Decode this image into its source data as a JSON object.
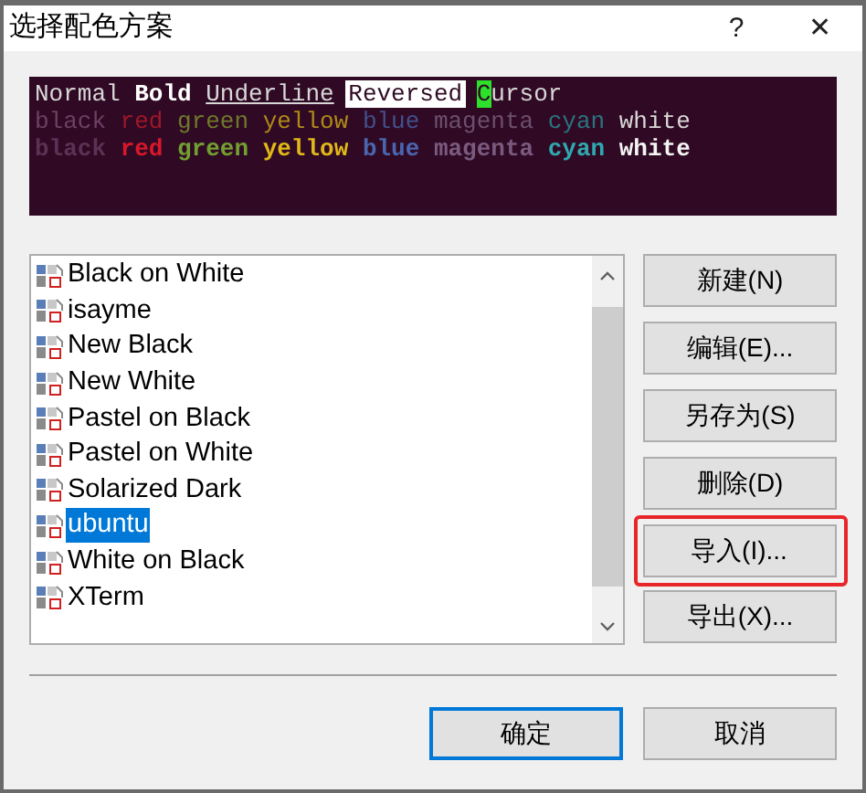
{
  "window": {
    "title": "选择配色方案",
    "help": "?",
    "close": "✕"
  },
  "preview": {
    "lines": [
      {
        "words": [
          {
            "parts": [
              {
                "text": "Normal",
                "kind": "normal",
                "color": "#d8d8d8"
              }
            ]
          },
          {
            "parts": [
              {
                "text": "Bold",
                "kind": "bold",
                "color": "#ffffff"
              }
            ]
          },
          {
            "parts": [
              {
                "text": "Underline",
                "kind": "underline",
                "color": "#d8d8d8"
              }
            ]
          },
          {
            "parts": [
              {
                "text": "Reversed",
                "kind": "reversed",
                "color": "#ffffff"
              }
            ]
          },
          {
            "parts": [
              {
                "text": "C",
                "kind": "cursor",
                "color": "#2ce02c"
              },
              {
                "text": "ursor",
                "kind": "normal",
                "color": "#d8d8d8"
              }
            ]
          }
        ]
      },
      {
        "words": [
          {
            "parts": [
              {
                "text": "black",
                "kind": "normal",
                "color": "#6e4064"
              }
            ]
          },
          {
            "parts": [
              {
                "text": "red",
                "kind": "normal",
                "color": "#a0162a"
              }
            ]
          },
          {
            "parts": [
              {
                "text": "green",
                "kind": "normal",
                "color": "#6e7a2a"
              }
            ]
          },
          {
            "parts": [
              {
                "text": "yellow",
                "kind": "normal",
                "color": "#b08a18"
              }
            ]
          },
          {
            "parts": [
              {
                "text": "blue",
                "kind": "normal",
                "color": "#42508e"
              }
            ]
          },
          {
            "parts": [
              {
                "text": "magenta",
                "kind": "normal",
                "color": "#6c4f6e"
              }
            ]
          },
          {
            "parts": [
              {
                "text": "cyan",
                "kind": "normal",
                "color": "#2a7480"
              }
            ]
          },
          {
            "parts": [
              {
                "text": "white",
                "kind": "normal",
                "color": "#d8d8d8"
              }
            ]
          }
        ]
      },
      {
        "words": [
          {
            "parts": [
              {
                "text": "black",
                "kind": "bold",
                "color": "#5c3254"
              }
            ]
          },
          {
            "parts": [
              {
                "text": "red",
                "kind": "bold",
                "color": "#d8182a"
              }
            ]
          },
          {
            "parts": [
              {
                "text": "green",
                "kind": "bold",
                "color": "#72a030"
              }
            ]
          },
          {
            "parts": [
              {
                "text": "yellow",
                "kind": "bold",
                "color": "#e0b818"
              }
            ]
          },
          {
            "parts": [
              {
                "text": "blue",
                "kind": "bold",
                "color": "#4a66b0"
              }
            ]
          },
          {
            "parts": [
              {
                "text": "magenta",
                "kind": "bold",
                "color": "#7a5a80"
              }
            ]
          },
          {
            "parts": [
              {
                "text": "cyan",
                "kind": "bold",
                "color": "#30a8b0"
              }
            ]
          },
          {
            "parts": [
              {
                "text": "white",
                "kind": "bold",
                "color": "#f4f4f4"
              }
            ]
          }
        ]
      }
    ]
  },
  "schemes": [
    {
      "label": "Black on White",
      "selected": false
    },
    {
      "label": "isayme",
      "selected": false
    },
    {
      "label": "New Black",
      "selected": false
    },
    {
      "label": "New White",
      "selected": false
    },
    {
      "label": "Pastel on Black",
      "selected": false
    },
    {
      "label": "Pastel on White",
      "selected": false
    },
    {
      "label": "Solarized Dark",
      "selected": false
    },
    {
      "label": "ubuntu",
      "selected": true
    },
    {
      "label": "White on Black",
      "selected": false
    },
    {
      "label": "XTerm",
      "selected": false
    }
  ],
  "actions": [
    {
      "label": "新建(N)",
      "highlighted": false
    },
    {
      "label": "编辑(E)...",
      "highlighted": false
    },
    {
      "label": "另存为(S)",
      "highlighted": false
    },
    {
      "label": "删除(D)",
      "highlighted": false
    },
    {
      "label": "导入(I)...",
      "highlighted": true
    },
    {
      "label": "导出(X)...",
      "highlighted": false
    }
  ],
  "footer": [
    {
      "label": "确定",
      "default": true
    },
    {
      "label": "取消",
      "default": false
    }
  ]
}
